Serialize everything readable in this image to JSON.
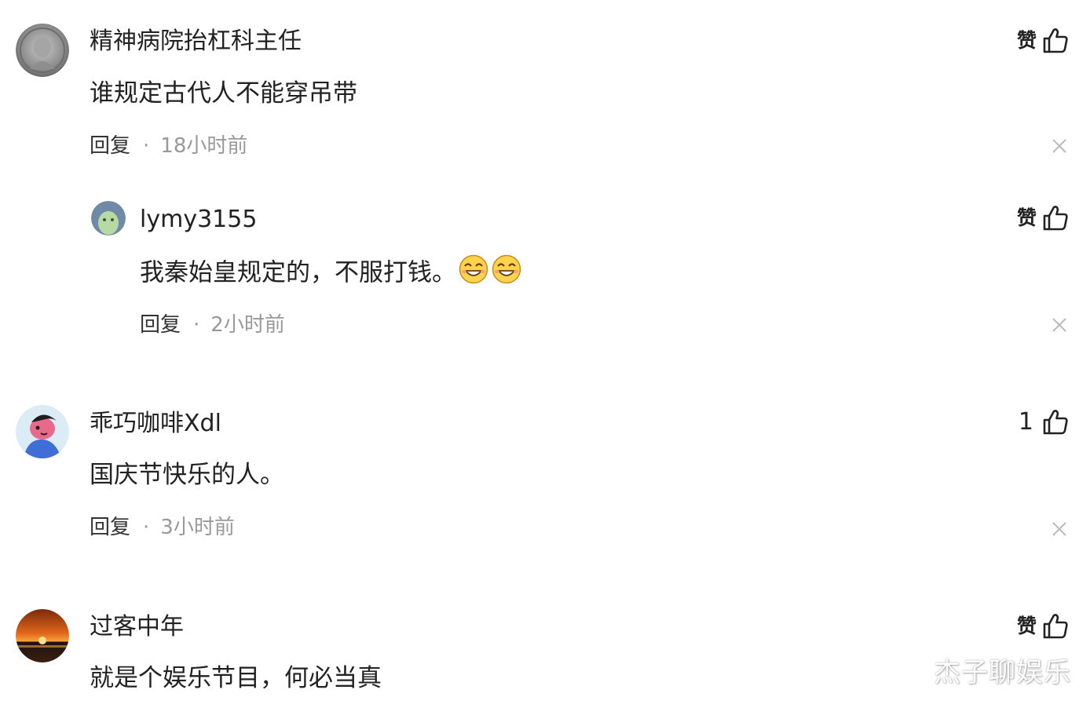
{
  "colors": {
    "text_primary": "#222222",
    "text_secondary": "#999999",
    "background": "#ffffff"
  },
  "comments": [
    {
      "username": "精神病院抬杠科主任",
      "content": "谁规定古代人不能穿吊带",
      "reply_label": "回复",
      "separator": "·",
      "time": "18小时前",
      "like_label": "赞",
      "avatar_icon": "coin-portrait-avatar",
      "reply": {
        "username": "lymy3155",
        "content": "我秦始皇规定的，不服打钱。",
        "emojis": [
          "smile-emoji",
          "smile-emoji"
        ],
        "reply_label": "回复",
        "separator": "·",
        "time": "2小时前",
        "like_label": "赞",
        "avatar_icon": "green-figure-avatar"
      }
    },
    {
      "username": "乖巧咖啡Xdl",
      "content": "国庆节快乐的人。",
      "reply_label": "回复",
      "separator": "·",
      "time": "3小时前",
      "like_count": "1",
      "avatar_icon": "cartoon-character-avatar"
    },
    {
      "username": "过客中年",
      "content": "就是个娱乐节目，何必当真",
      "like_label": "赞",
      "avatar_icon": "sunset-avatar"
    }
  ],
  "watermark": "杰子聊娱乐"
}
